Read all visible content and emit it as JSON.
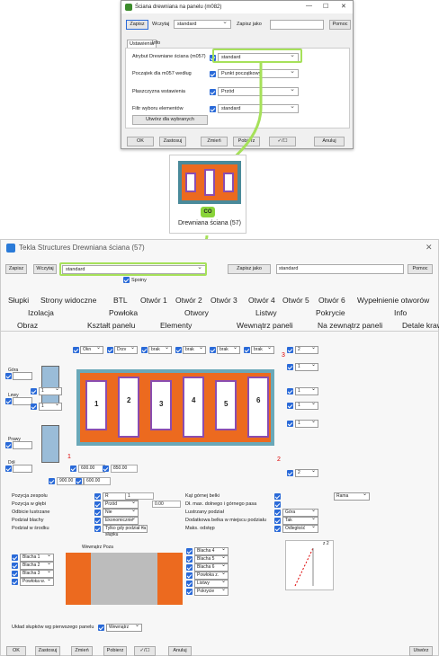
{
  "small_dialog": {
    "title": "Ściana drewniana na panelu (m082)",
    "save": "Zapisz",
    "load": "Wczytaj",
    "preset": "standard",
    "save_as": "Zapisz jako",
    "help": "Pomoc",
    "tabs": [
      "Ustawienia",
      "Info"
    ],
    "rows": [
      {
        "label": "Atrybut Drewniane ściana (m057)",
        "value": "standard"
      },
      {
        "label": "Początek dla m057 według",
        "value": "Punkt początkowy"
      },
      {
        "label": "Płaszczyzna wstawienia",
        "value": "Przód"
      },
      {
        "label": "Filtr wyboru elementów",
        "value": "standard"
      }
    ],
    "create_selected": "Utwórz dla wybranych",
    "buttons": {
      "ok": "OK",
      "apply": "Zastosuj",
      "modify": "Zmień",
      "get": "Pobierz",
      "toggle": "✓/☐",
      "cancel": "Anuluj"
    }
  },
  "component": {
    "label": "Drewniana ściana (57)",
    "badge": "CO"
  },
  "main": {
    "title": "Tekla Structures  Drewniana ściana (57)",
    "save": "Zapisz",
    "load": "Wczytaj",
    "preset": "standard",
    "save_as": "Zapisz jako",
    "save_as_value": "standard",
    "help": "Pomoc",
    "joints": "Spoiny",
    "tabs_row1": [
      "Słupki",
      "Strony widoczne",
      "BTL",
      "Otwór 1",
      "Otwór 2",
      "Otwór 3",
      "Otwór 4",
      "Otwór 5",
      "Otwór 6",
      "Wypełnienie otworów"
    ],
    "tabs_row2": [
      "Izolacja",
      "Powłoka",
      "Otwory",
      "Listwy",
      "Pokrycie",
      "Info"
    ],
    "tabs_row3": [
      "Obraz",
      "Kształt panelu",
      "Elementy",
      "Wewnątrz paneli",
      "Na zewnątrz paneli",
      "Detale krawędzi"
    ],
    "side_labels": {
      "top": "Góra",
      "left": "Lewy",
      "right": "Prawy",
      "bottom": "Dół"
    },
    "top_selects": [
      "Okn",
      "Drzv",
      "brak",
      "brak",
      "brak",
      "brak"
    ],
    "right_selects": [
      "2",
      "1",
      "1",
      "1",
      "1",
      "2"
    ],
    "left_selects": [
      "1",
      "1"
    ],
    "window_numbers": [
      "1",
      "2",
      "3",
      "4",
      "5",
      "6"
    ],
    "dims": [
      "600.00",
      "850.00",
      "900.00",
      "600.00"
    ],
    "red_numbers": [
      "3",
      "1",
      "2"
    ],
    "props": [
      {
        "label": "Pozycja zespołu",
        "v1": "R",
        "v2": "1"
      },
      {
        "label": "Pozycja w głębi",
        "v1": "Przód",
        "v2": "0.00"
      },
      {
        "label": "Odbicie lustrzane",
        "v1": "Nie"
      },
      {
        "label": "Podział blachy",
        "v1": "Ekonomicznie"
      },
      {
        "label": "Podział w środku",
        "v1": "Tylko gdy podział na słupku"
      }
    ],
    "props_right": [
      {
        "label": "Kąt górnej belki",
        "v": "Rama"
      },
      {
        "label": "Dł. max. dolnego i górnego pasa"
      },
      {
        "label": "Lustrzany podział",
        "v": "Góra"
      },
      {
        "label": "Dodatkowa belka w miejscu podziału",
        "v": "Tak"
      },
      {
        "label": "Maks. odstęp",
        "v": "Odległość"
      }
    ],
    "inside_outside": "Wewnątrz Poza",
    "left_list": [
      "Blacha 1",
      "Blacha 2",
      "Blacha 3",
      "Powłoka w."
    ],
    "right_list": [
      "Blacha 4",
      "Blacha 5",
      "Blacha 6",
      "Powłoka z.",
      "Listwy",
      "Pokrycie"
    ],
    "z2": "z 2",
    "posts_label": "Układ słupków wg pierwszego panelu",
    "posts_value": "Wewnątrz",
    "buttons": {
      "ok": "OK",
      "apply": "Zastosuj",
      "modify": "Zmień",
      "get": "Pobierz",
      "toggle": "✓/☐",
      "cancel": "Anuluj",
      "create": "Utwórz"
    }
  }
}
